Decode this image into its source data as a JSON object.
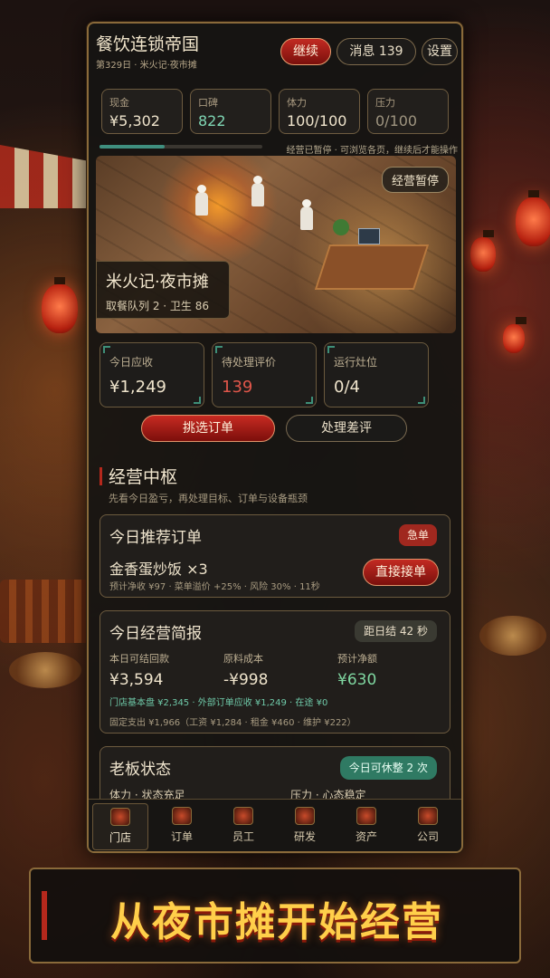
{
  "header": {
    "title": "餐饮连锁帝国",
    "subtitle": "第329日 · 米火记·夜市摊",
    "continue_label": "继续",
    "messages_label": "消息 139",
    "settings_label": "设置"
  },
  "stats": [
    {
      "label": "现金",
      "value": "¥5,302"
    },
    {
      "label": "口碑",
      "value": "822"
    },
    {
      "label": "体力",
      "value": "100/100"
    },
    {
      "label": "压力",
      "value": "0/100"
    }
  ],
  "progress": {
    "fraction": 0.4,
    "note": "经营已暂停 · 可浏览各页，继续后才能操作"
  },
  "scene": {
    "badge": "经营暂停",
    "store_name": "米火记·夜市摊",
    "store_meta": "取餐队列 2 · 卫生 86"
  },
  "kpis": [
    {
      "label": "今日应收",
      "value": "¥1,249"
    },
    {
      "label": "待处理评价",
      "value": "139"
    },
    {
      "label": "运行灶位",
      "value": "0/4"
    }
  ],
  "actions": {
    "pick_orders": "挑选订单",
    "handle_reviews": "处理差评"
  },
  "section": {
    "title": "经营中枢",
    "desc": "先看今日盈亏，再处理目标、订单与设备瓶颈"
  },
  "order_card": {
    "title": "今日推荐订单",
    "tag": "急单",
    "dish": "金香蛋炒饭 ×3",
    "meta": "预计净收 ¥97 · 菜单溢价 +25% · 风险 30% · 11秒",
    "accept_label": "直接接单"
  },
  "brief_card": {
    "title": "今日经营简报",
    "timer": "距日结 42 秒",
    "cols": [
      {
        "label": "本日可结回款",
        "value": "¥3,594"
      },
      {
        "label": "原料成本",
        "value": "-¥998"
      },
      {
        "label": "预计净额",
        "value": "¥630"
      }
    ],
    "line1": "门店基本盘 ¥2,345 · 外部订单应收 ¥1,249 · 在途 ¥0",
    "line2": "固定支出 ¥1,966（工资 ¥1,284 · 租金 ¥460 · 维护 ¥222）"
  },
  "boss_card": {
    "title": "老板状态",
    "tag": "今日可休整 2 次",
    "left": "体力 · 状态充足",
    "right": "压力 · 心态稳定"
  },
  "tabs": [
    {
      "label": "门店",
      "icon": "storefront-icon"
    },
    {
      "label": "订单",
      "icon": "order-icon"
    },
    {
      "label": "员工",
      "icon": "staff-icon"
    },
    {
      "label": "研发",
      "icon": "research-icon"
    },
    {
      "label": "资产",
      "icon": "assets-icon"
    },
    {
      "label": "公司",
      "icon": "company-icon"
    }
  ],
  "banner": {
    "text": "从夜市摊开始经营"
  },
  "colors": {
    "accent_red": "#b5281c",
    "accent_teal": "#3f8f7f",
    "gold": "#ffcf4a"
  }
}
